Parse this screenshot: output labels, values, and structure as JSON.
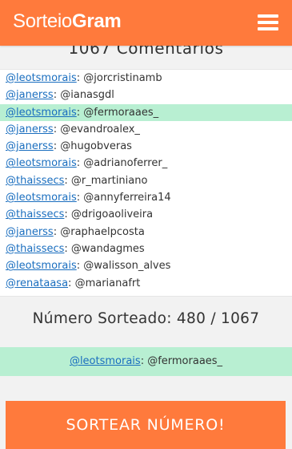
{
  "header": {
    "logo_light": "Sorteio",
    "logo_bold": "Gram",
    "menu_icon": "hamburger-menu-icon",
    "bg_color": "#ff7a3c"
  },
  "count_title": "1067 Comentarios",
  "comments": [
    {
      "user": "@leotsmorais",
      "sep": ": ",
      "text": "@jorcristinamb",
      "highlight": false
    },
    {
      "user": "@janerss",
      "sep": ": ",
      "text": "@ianasgdl",
      "highlight": false
    },
    {
      "user": "@leotsmorais",
      "sep": ": ",
      "text": "@fermoraaes_",
      "highlight": true
    },
    {
      "user": "@janerss",
      "sep": ": ",
      "text": "@evandroalex_",
      "highlight": false
    },
    {
      "user": "@janerss",
      "sep": ": ",
      "text": "@hugobveras",
      "highlight": false
    },
    {
      "user": "@leotsmorais",
      "sep": ": ",
      "text": "@adrianoferrer_",
      "highlight": false
    },
    {
      "user": "@thaissecs",
      "sep": ": ",
      "text": "@r_martiniano",
      "highlight": false
    },
    {
      "user": "@leotsmorais",
      "sep": ": ",
      "text": "@annyferreira14",
      "highlight": false
    },
    {
      "user": "@thaissecs",
      "sep": ": ",
      "text": "@drigoaoliveira",
      "highlight": false
    },
    {
      "user": "@janerss",
      "sep": ": ",
      "text": "@raphaelpcosta",
      "highlight": false
    },
    {
      "user": "@thaissecs",
      "sep": ": ",
      "text": "@wandagmes",
      "highlight": false
    },
    {
      "user": "@leotsmorais",
      "sep": ": ",
      "text": "@walisson_alves",
      "highlight": false
    },
    {
      "user": "@renataasa",
      "sep": ": ",
      "text": "@marianafrt",
      "highlight": false
    }
  ],
  "result_title": "Número Sorteado: 480 / 1067",
  "winner": {
    "user": "@leotsmorais",
    "sep": ": ",
    "text": "@fermoraaes_"
  },
  "draw_button_label": "SORTEAR NÚMERO!",
  "colors": {
    "accent": "#ff7a3c",
    "highlight": "#b8efd2",
    "link": "#1a6ebf"
  }
}
